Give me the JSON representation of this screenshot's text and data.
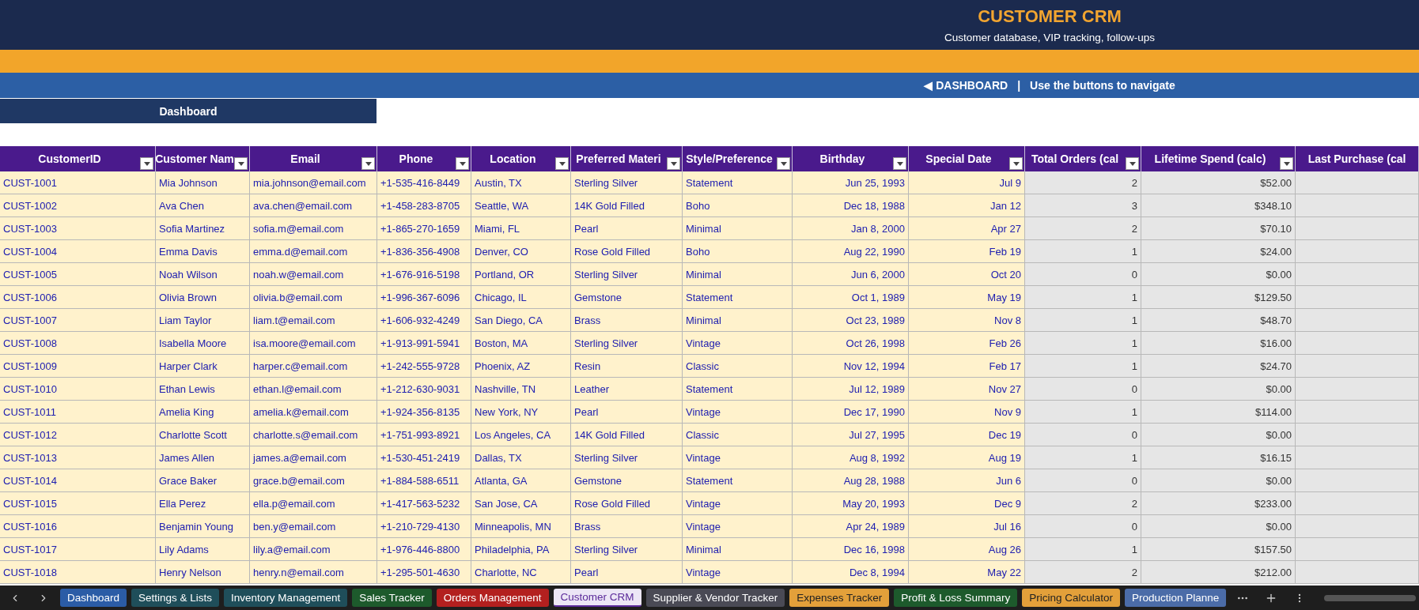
{
  "header": {
    "title": "CUSTOMER CRM",
    "subtitle": "Customer database, VIP tracking, follow-ups"
  },
  "nav": {
    "link": "◀ DASHBOARD",
    "separator": "|",
    "hint": "Use the buttons to navigate"
  },
  "dashboard_button": "Dashboard",
  "table": {
    "columns": [
      {
        "label": "CustomerID",
        "kind": "text",
        "filter": true
      },
      {
        "label": "Customer Nam",
        "kind": "text",
        "filter": true
      },
      {
        "label": "Email",
        "kind": "text",
        "filter": true
      },
      {
        "label": "Phone",
        "kind": "text",
        "filter": true
      },
      {
        "label": "Location",
        "kind": "text",
        "filter": true
      },
      {
        "label": "Preferred Materi",
        "kind": "text",
        "filter": true
      },
      {
        "label": "Style/Preference",
        "kind": "text",
        "filter": true
      },
      {
        "label": "Birthday",
        "kind": "date",
        "filter": true
      },
      {
        "label": "Special Date",
        "kind": "date",
        "filter": true
      },
      {
        "label": "Total Orders (cal",
        "kind": "calc",
        "filter": true
      },
      {
        "label": "Lifetime Spend (calc)",
        "kind": "calc",
        "filter": true
      },
      {
        "label": "Last Purchase (cal",
        "kind": "calc",
        "filter": false
      }
    ],
    "rows": [
      [
        "CUST-1001",
        "Mia Johnson",
        "mia.johnson@email.com",
        "+1-535-416-8449",
        "Austin, TX",
        "Sterling Silver",
        "Statement",
        "Jun 25, 1993",
        "Jul 9",
        "2",
        "$52.00"
      ],
      [
        "CUST-1002",
        "Ava Chen",
        "ava.chen@email.com",
        "+1-458-283-8705",
        "Seattle, WA",
        "14K Gold Filled",
        "Boho",
        "Dec 18, 1988",
        "Jan 12",
        "3",
        "$348.10"
      ],
      [
        "CUST-1003",
        "Sofia Martinez",
        "sofia.m@email.com",
        "+1-865-270-1659",
        "Miami, FL",
        "Pearl",
        "Minimal",
        "Jan 8, 2000",
        "Apr 27",
        "2",
        "$70.10"
      ],
      [
        "CUST-1004",
        "Emma Davis",
        "emma.d@email.com",
        "+1-836-356-4908",
        "Denver, CO",
        "Rose Gold Filled",
        "Boho",
        "Aug 22, 1990",
        "Feb 19",
        "1",
        "$24.00"
      ],
      [
        "CUST-1005",
        "Noah Wilson",
        "noah.w@email.com",
        "+1-676-916-5198",
        "Portland, OR",
        "Sterling Silver",
        "Minimal",
        "Jun 6, 2000",
        "Oct 20",
        "0",
        "$0.00"
      ],
      [
        "CUST-1006",
        "Olivia Brown",
        "olivia.b@email.com",
        "+1-996-367-6096",
        "Chicago, IL",
        "Gemstone",
        "Statement",
        "Oct 1, 1989",
        "May 19",
        "1",
        "$129.50"
      ],
      [
        "CUST-1007",
        "Liam Taylor",
        "liam.t@email.com",
        "+1-606-932-4249",
        "San Diego, CA",
        "Brass",
        "Minimal",
        "Oct 23, 1989",
        "Nov 8",
        "1",
        "$48.70"
      ],
      [
        "CUST-1008",
        "Isabella Moore",
        "isa.moore@email.com",
        "+1-913-991-5941",
        "Boston, MA",
        "Sterling Silver",
        "Vintage",
        "Oct 26, 1998",
        "Feb 26",
        "1",
        "$16.00"
      ],
      [
        "CUST-1009",
        "Harper Clark",
        "harper.c@email.com",
        "+1-242-555-9728",
        "Phoenix, AZ",
        "Resin",
        "Classic",
        "Nov 12, 1994",
        "Feb 17",
        "1",
        "$24.70"
      ],
      [
        "CUST-1010",
        "Ethan Lewis",
        "ethan.l@email.com",
        "+1-212-630-9031",
        "Nashville, TN",
        "Leather",
        "Statement",
        "Jul 12, 1989",
        "Nov 27",
        "0",
        "$0.00"
      ],
      [
        "CUST-1011",
        "Amelia King",
        "amelia.k@email.com",
        "+1-924-356-8135",
        "New York, NY",
        "Pearl",
        "Vintage",
        "Dec 17, 1990",
        "Nov 9",
        "1",
        "$114.00"
      ],
      [
        "CUST-1012",
        "Charlotte Scott",
        "charlotte.s@email.com",
        "+1-751-993-8921",
        "Los Angeles, CA",
        "14K Gold Filled",
        "Classic",
        "Jul 27, 1995",
        "Dec 19",
        "0",
        "$0.00"
      ],
      [
        "CUST-1013",
        "James Allen",
        "james.a@email.com",
        "+1-530-451-2419",
        "Dallas, TX",
        "Sterling Silver",
        "Vintage",
        "Aug 8, 1992",
        "Aug 19",
        "1",
        "$16.15"
      ],
      [
        "CUST-1014",
        "Grace Baker",
        "grace.b@email.com",
        "+1-884-588-6511",
        "Atlanta, GA",
        "Gemstone",
        "Statement",
        "Aug 28, 1988",
        "Jun 6",
        "0",
        "$0.00"
      ],
      [
        "CUST-1015",
        "Ella Perez",
        "ella.p@email.com",
        "+1-417-563-5232",
        "San Jose, CA",
        "Rose Gold Filled",
        "Vintage",
        "May 20, 1993",
        "Dec 9",
        "2",
        "$233.00"
      ],
      [
        "CUST-1016",
        "Benjamin Young",
        "ben.y@email.com",
        "+1-210-729-4130",
        "Minneapolis, MN",
        "Brass",
        "Vintage",
        "Apr 24, 1989",
        "Jul 16",
        "0",
        "$0.00"
      ],
      [
        "CUST-1017",
        "Lily Adams",
        "lily.a@email.com",
        "+1-976-446-8800",
        "Philadelphia, PA",
        "Sterling Silver",
        "Minimal",
        "Dec 16, 1998",
        "Aug 26",
        "1",
        "$157.50"
      ],
      [
        "CUST-1018",
        "Henry Nelson",
        "henry.n@email.com",
        "+1-295-501-4630",
        "Charlotte, NC",
        "Pearl",
        "Vintage",
        "Dec 8, 1994",
        "May 22",
        "2",
        "$212.00"
      ]
    ]
  },
  "sheet_tabs": [
    {
      "label": "Dashboard",
      "color": "#2b5ca6",
      "selected": false
    },
    {
      "label": "Settings & Lists",
      "color": "#1f4e5a",
      "selected": false
    },
    {
      "label": "Inventory Management",
      "color": "#1f4e5a",
      "selected": false
    },
    {
      "label": "Sales Tracker",
      "color": "#1d5a2c",
      "selected": false
    },
    {
      "label": "Orders Management",
      "color": "#b3201f",
      "selected": false
    },
    {
      "label": "Customer CRM",
      "color": "#5b2a9a",
      "selected": true
    },
    {
      "label": "Supplier & Vendor Tracker",
      "color": "#4a4a55",
      "selected": false
    },
    {
      "label": "Expenses Tracker",
      "color": "#e3a03a",
      "selected": false
    },
    {
      "label": "Profit & Loss Summary",
      "color": "#1d5a2c",
      "selected": false
    },
    {
      "label": "Pricing Calculator",
      "color": "#e3a03a",
      "selected": false
    },
    {
      "label": "Production Planne",
      "color": "#4b6ca8",
      "selected": false
    }
  ]
}
